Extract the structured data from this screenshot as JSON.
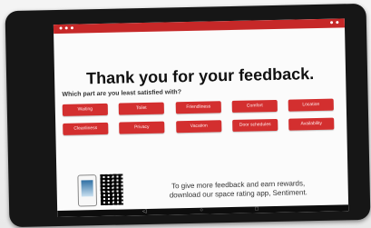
{
  "page": {
    "title": "Thank you for your feedback.",
    "subtitle": "Which part are you least satisfied with?",
    "promo_line_1": "To give more feedback and earn rewards,",
    "promo_line_2": "download our space rating app, Sentiment."
  },
  "status_bar": {
    "left": "● ● ●",
    "right": "● ●"
  },
  "options": [
    {
      "label": "Waiting"
    },
    {
      "label": "Toilet"
    },
    {
      "label": "Friendliness"
    },
    {
      "label": "Comfort"
    },
    {
      "label": "Location"
    },
    {
      "label": "Cleanliness"
    },
    {
      "label": "Privacy"
    },
    {
      "label": "Vacation"
    },
    {
      "label": "Door schedules"
    },
    {
      "label": "Availability"
    }
  ],
  "navbar": {
    "back": "◁",
    "home": "○",
    "recents": "□"
  },
  "colors": {
    "accent": "#d32f2f",
    "status_bar": "#c62828",
    "screen_bg": "#fbfbfb"
  }
}
